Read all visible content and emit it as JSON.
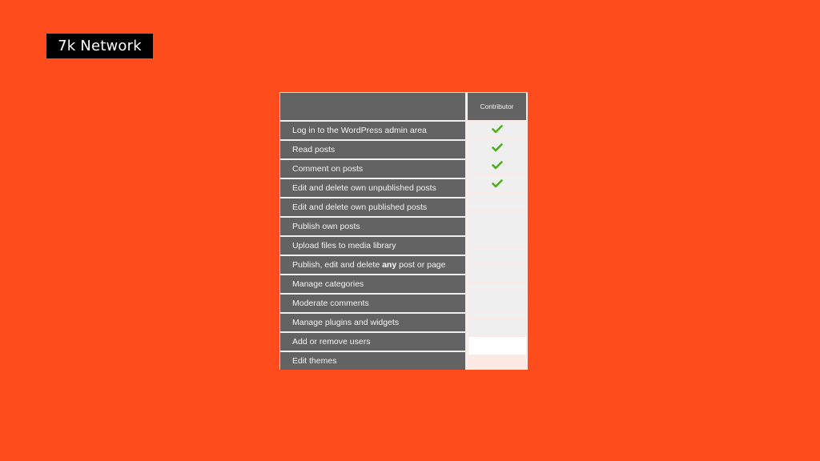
{
  "brand": {
    "label": "7k Network"
  },
  "table": {
    "column_header": "Contributor",
    "rows": [
      {
        "label": "Log in to the WordPress admin area",
        "allowed": true,
        "icon": "check-icon"
      },
      {
        "label": "Read posts",
        "allowed": true,
        "icon": "check-icon"
      },
      {
        "label": "Comment on posts",
        "allowed": true,
        "icon": "check-icon"
      },
      {
        "label": "Edit and delete own unpublished posts",
        "allowed": true,
        "icon": "check-icon"
      },
      {
        "label": "Edit and delete own published posts",
        "allowed": false
      },
      {
        "label": "Publish own posts",
        "allowed": false
      },
      {
        "label": "Upload files to media library",
        "allowed": false
      },
      {
        "label_pre": "Publish, edit and delete ",
        "label_bold": "any",
        "label_post": " post or page",
        "allowed": false
      },
      {
        "label": "Manage categories",
        "allowed": false
      },
      {
        "label": "Moderate comments",
        "allowed": false
      },
      {
        "label": "Manage plugins and widgets",
        "allowed": false
      },
      {
        "label": "Add or remove users",
        "allowed": false
      },
      {
        "label": "Edit themes",
        "allowed": false
      }
    ],
    "colors": {
      "background": "#ff4c1c",
      "header": "#636363",
      "check": "#4caf1a"
    }
  }
}
